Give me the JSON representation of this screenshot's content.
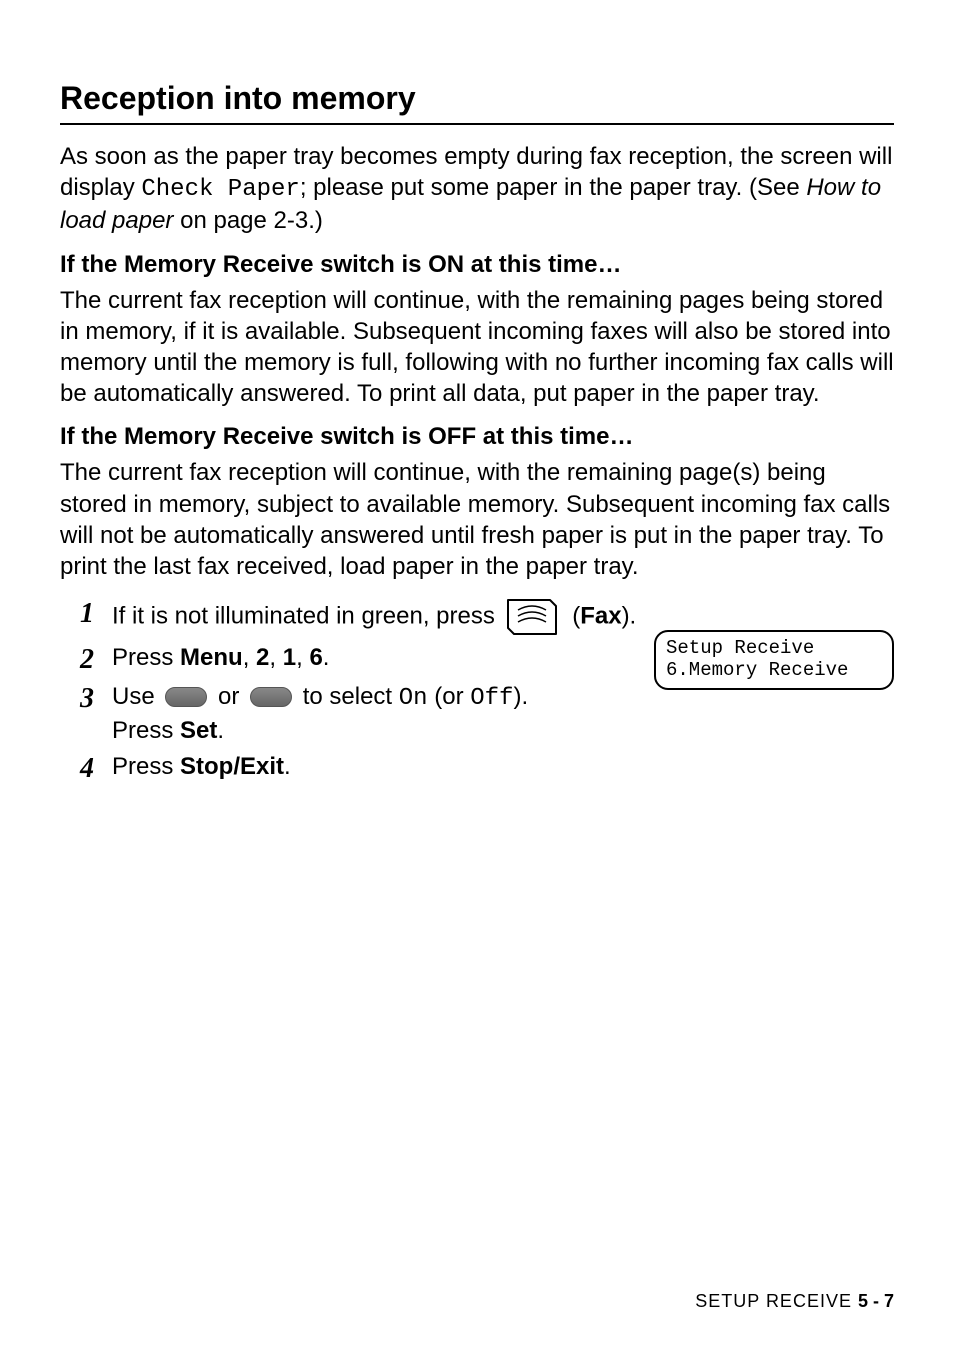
{
  "heading": "Reception into memory",
  "para1_a": "As soon as the paper tray becomes empty during fax reception, the screen will display ",
  "para1_mono": "Check Paper",
  "para1_b": "; please put some paper in the paper tray. (See ",
  "para1_ital": "How to load paper",
  "para1_c": " on page 2-3.)",
  "sub_on": "If the Memory Receive switch is ON at this time…",
  "para_on": "The current fax reception will continue, with the remaining pages being stored in memory, if it is available. Subsequent incoming faxes will also be stored into memory until the memory is full, following with no further incoming fax calls will be automatically answered. To print all data, put paper in the paper tray.",
  "sub_off": "If the Memory Receive switch is OFF at this time…",
  "para_off": "The current fax reception will continue, with the remaining page(s) being stored in memory, subject to available memory. Subsequent incoming fax calls will not be automatically answered until fresh paper is put in the paper tray. To print the last fax received, load paper in the paper tray.",
  "step1_num": "1",
  "step1_a": "If it is not illuminated in green, press ",
  "step1_b": " (",
  "step1_bold": "Fax",
  "step1_c": ").",
  "step2_num": "2",
  "step2_a": "Press ",
  "step2_bold": "Menu",
  "step2_b": ", ",
  "step2_bold2": "2",
  "step2_c": ", ",
  "step2_bold3": "1",
  "step2_d": ", ",
  "step2_bold4": "6",
  "step2_e": ".",
  "step3_num": "3",
  "step3_a": "Use ",
  "step3_b": " or ",
  "step3_c": " to select ",
  "step3_mono1": "On",
  "step3_d": " (or ",
  "step3_mono2": "Off",
  "step3_e": ").",
  "step3_f": "Press ",
  "step3_bold": "Set",
  "step3_g": ".",
  "step4_num": "4",
  "step4_a": "Press ",
  "step4_bold": "Stop/Exit",
  "step4_b": ".",
  "lcd_line1": "Setup Receive",
  "lcd_line2": "6.Memory Receive",
  "footer_chap": "SETUP RECEIVE  ",
  "footer_pgno": "5 - 7"
}
